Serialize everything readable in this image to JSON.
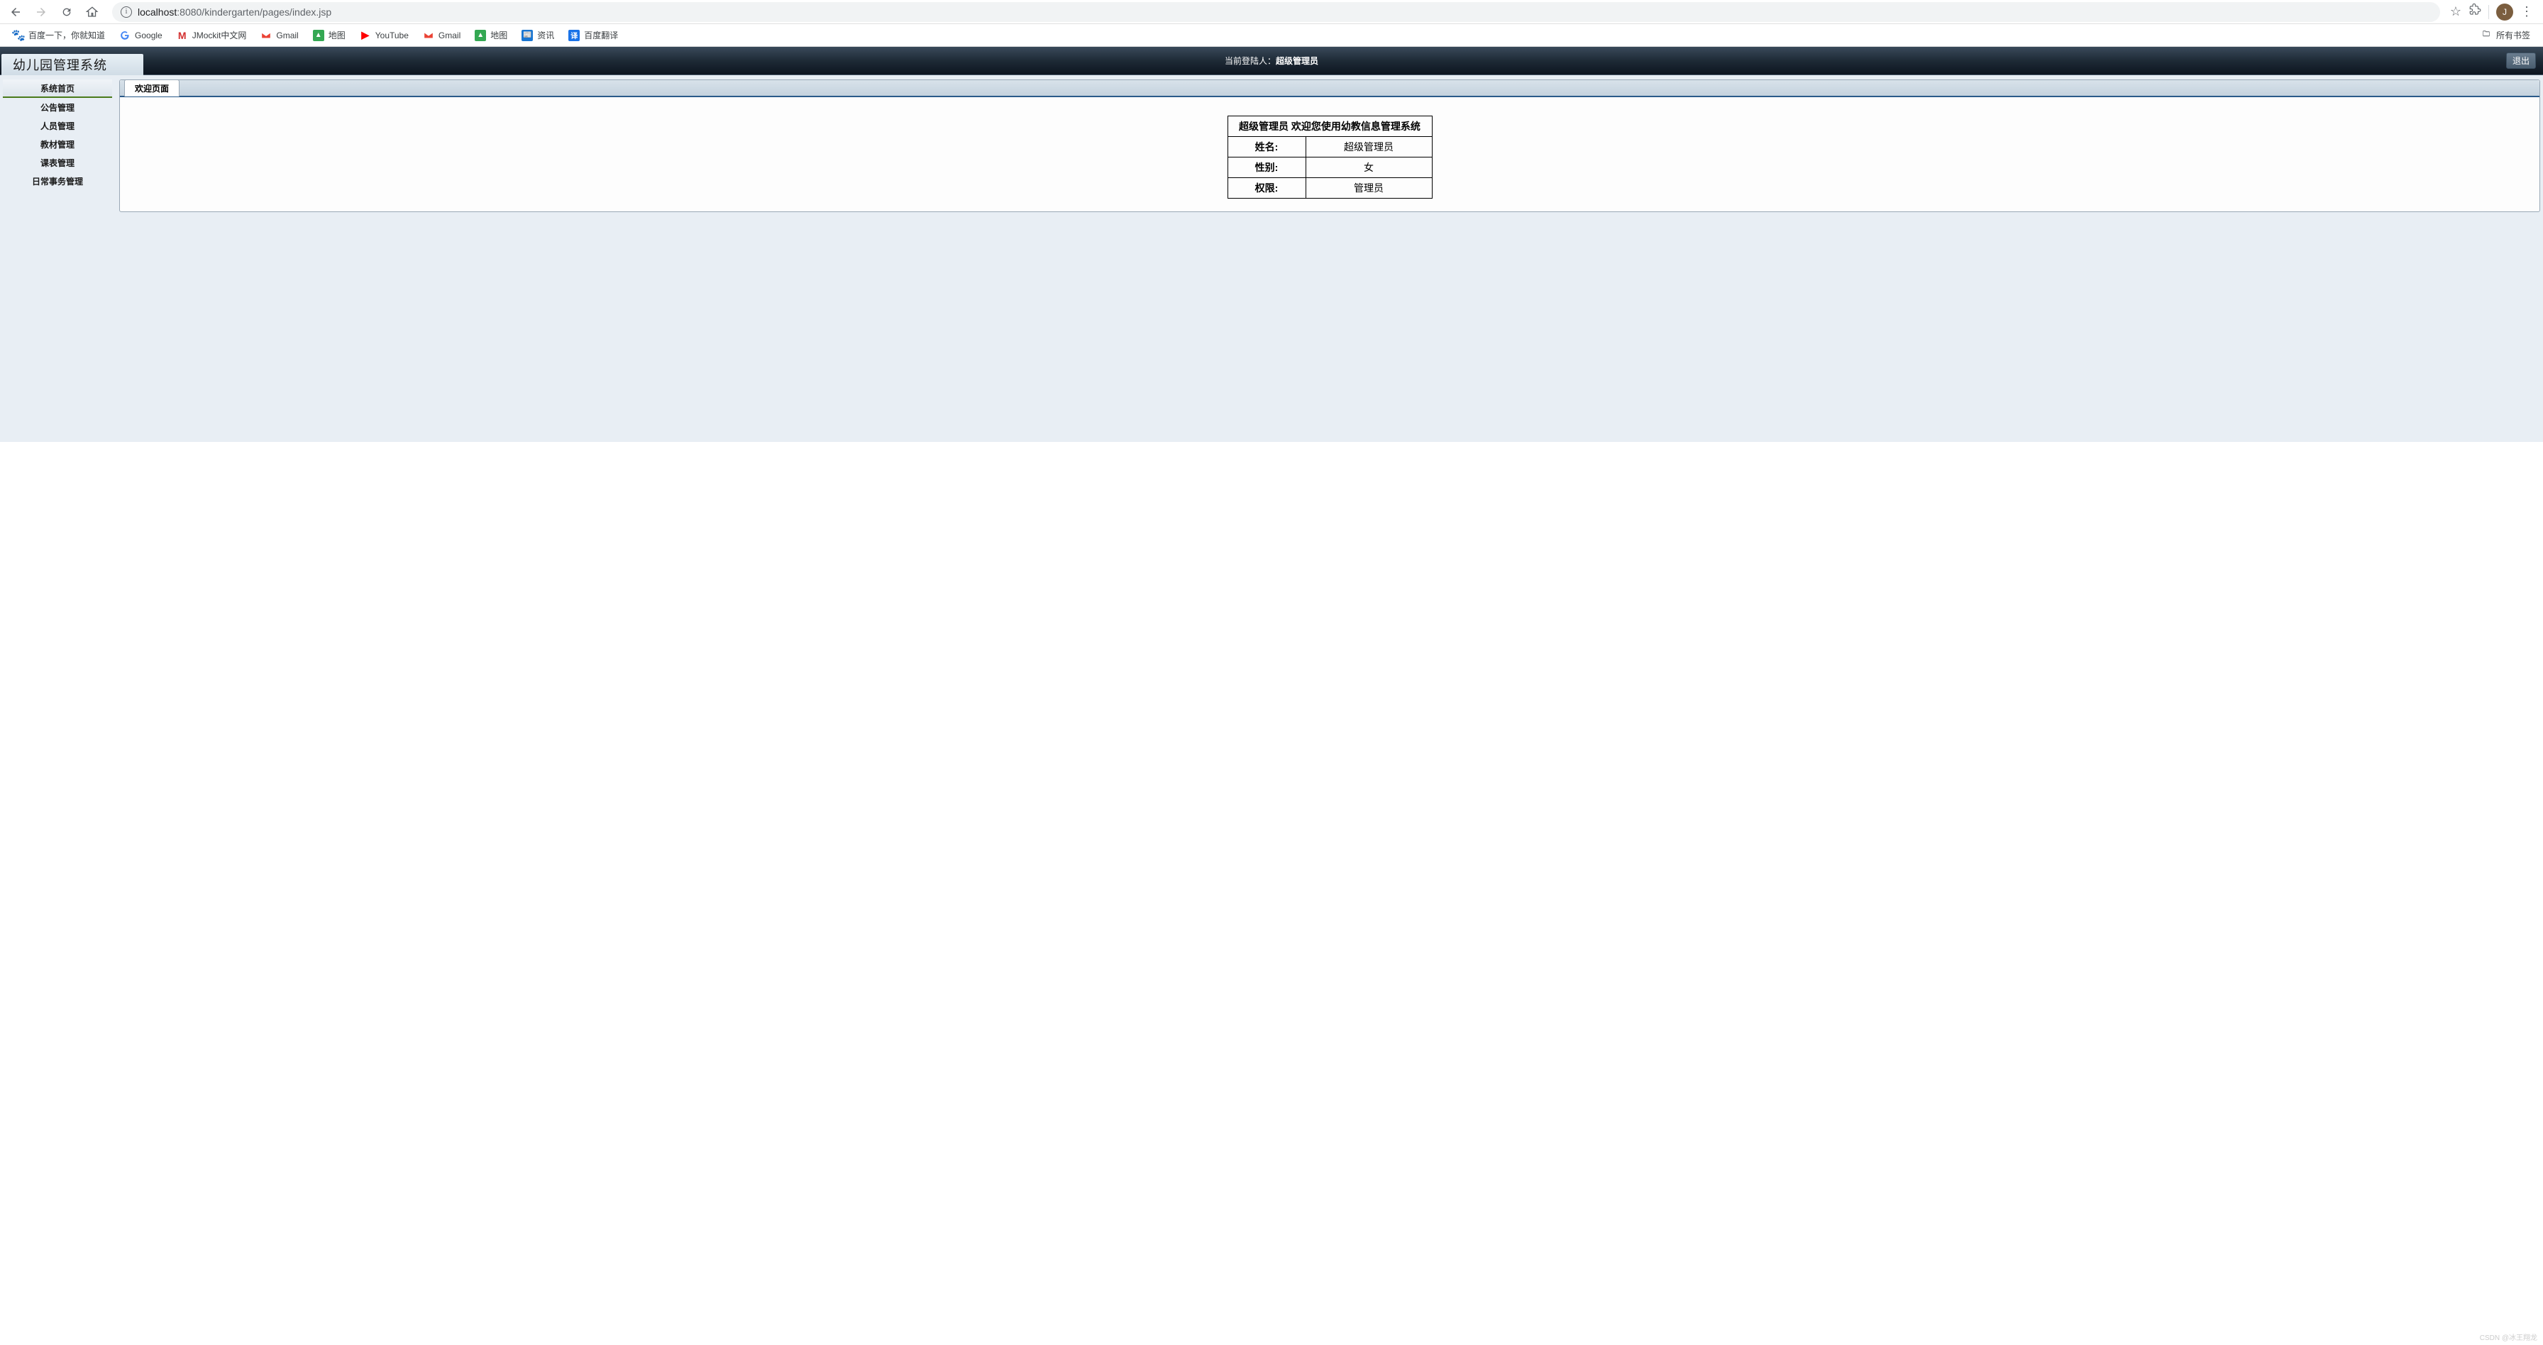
{
  "browser": {
    "url_host": "localhost",
    "url_port_path": ":8080/kindergarten/pages/index.jsp",
    "profile_initial": "J"
  },
  "bookmarks": {
    "items": [
      {
        "label": "百度一下，你就知道"
      },
      {
        "label": "Google"
      },
      {
        "label": "JMockit中文网"
      },
      {
        "label": "Gmail"
      },
      {
        "label": "地图"
      },
      {
        "label": "YouTube"
      },
      {
        "label": "Gmail"
      },
      {
        "label": "地图"
      },
      {
        "label": "资讯"
      },
      {
        "label": "百度翻译"
      }
    ],
    "all_label": "所有书签"
  },
  "app": {
    "title": "幼儿园管理系统",
    "login_label": "当前登陆人：",
    "login_user": "超级管理员",
    "logout": "退出"
  },
  "sidebar": {
    "items": [
      {
        "label": "系统首页"
      },
      {
        "label": "公告管理"
      },
      {
        "label": "人员管理"
      },
      {
        "label": "教材管理"
      },
      {
        "label": "课表管理"
      },
      {
        "label": "日常事务管理"
      }
    ]
  },
  "tab": {
    "label": "欢迎页面"
  },
  "welcome": {
    "heading": "超级管理员 欢迎您使用幼教信息管理系统",
    "rows": [
      {
        "label": "姓名:",
        "value": "超级管理员"
      },
      {
        "label": "性别:",
        "value": "女"
      },
      {
        "label": "权限:",
        "value": "管理员"
      }
    ]
  },
  "watermark": "CSDN @冰王翔龙"
}
